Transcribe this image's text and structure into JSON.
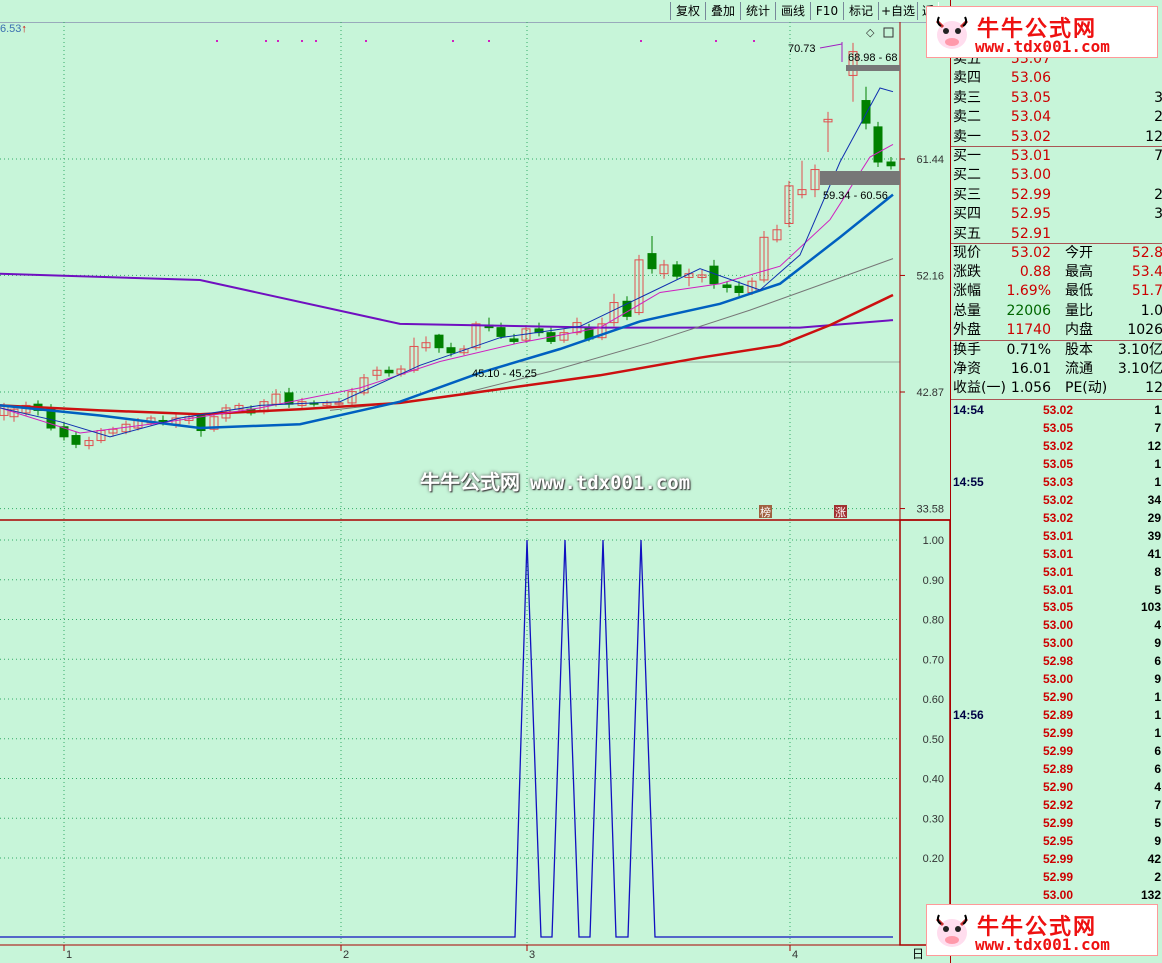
{
  "toolbar": {
    "buttons": [
      "复权",
      "叠加",
      "统计",
      "画线",
      "F10",
      "标记",
      "+自选",
      "返"
    ]
  },
  "chart": {
    "top_price_label": "6.53",
    "price_axis": [
      "61.44",
      "52.16",
      "42.87",
      "33.58"
    ],
    "indicator_axis": [
      "1.00",
      "0.90",
      "0.80",
      "0.70",
      "0.60",
      "0.50",
      "0.40",
      "0.30",
      "0.20"
    ],
    "x_axis": [
      "1",
      "2",
      "3",
      "4"
    ],
    "annotation_high": "70.73",
    "annotation_range_top": "68.98 - 68",
    "annotation_range_mid": "59.34 - 60.56",
    "annotation_range_low": "45.10 - 45.25",
    "badge_left": "榜",
    "badge_right": "涨",
    "bottom_right_label": "日",
    "watermark_cn": "牛牛公式网",
    "watermark_url": "www.tdx001.com"
  },
  "quote": {
    "sell": [
      {
        "label": "卖五",
        "price": "53.07",
        "vol": ""
      },
      {
        "label": "卖四",
        "price": "53.06",
        "vol": ""
      },
      {
        "label": "卖三",
        "price": "53.05",
        "vol": "3"
      },
      {
        "label": "卖二",
        "price": "53.04",
        "vol": "2"
      },
      {
        "label": "卖一",
        "price": "53.02",
        "vol": "12"
      }
    ],
    "buy": [
      {
        "label": "买一",
        "price": "53.01",
        "vol": "7"
      },
      {
        "label": "买二",
        "price": "53.00",
        "vol": ""
      },
      {
        "label": "买三",
        "price": "52.99",
        "vol": "2"
      },
      {
        "label": "买四",
        "price": "52.95",
        "vol": "3"
      },
      {
        "label": "买五",
        "price": "52.91",
        "vol": ""
      }
    ],
    "stats": [
      {
        "l1": "现价",
        "v1": "53.02",
        "l2": "今开",
        "v2": "52.8"
      },
      {
        "l1": "涨跌",
        "v1": "0.88",
        "l2": "最高",
        "v2": "53.4"
      },
      {
        "l1": "涨幅",
        "v1": "1.69%",
        "l2": "最低",
        "v2": "51.7"
      },
      {
        "l1": "总量",
        "v1": "22006",
        "l2": "量比",
        "v2": "1.0"
      },
      {
        "l1": "外盘",
        "v1": "11740",
        "l2": "内盘",
        "v2": "1026"
      }
    ],
    "stats2": [
      {
        "l1": "换手",
        "v1": "0.71%",
        "l2": "股本",
        "v2": "3.10亿"
      },
      {
        "l1": "净资",
        "v1": "16.01",
        "l2": "流通",
        "v2": "3.10亿"
      },
      {
        "l1": "收益(一)",
        "v1": "1.056",
        "l2": "PE(动)",
        "v2": "12"
      }
    ]
  },
  "ticks": [
    {
      "time": "14:54",
      "price": "53.02",
      "vol": "1"
    },
    {
      "time": "",
      "price": "53.05",
      "vol": "7"
    },
    {
      "time": "",
      "price": "53.02",
      "vol": "12"
    },
    {
      "time": "",
      "price": "53.05",
      "vol": "1"
    },
    {
      "time": "14:55",
      "price": "53.03",
      "vol": "1"
    },
    {
      "time": "",
      "price": "53.02",
      "vol": "34"
    },
    {
      "time": "",
      "price": "53.02",
      "vol": "29"
    },
    {
      "time": "",
      "price": "53.01",
      "vol": "39"
    },
    {
      "time": "",
      "price": "53.01",
      "vol": "41"
    },
    {
      "time": "",
      "price": "53.01",
      "vol": "8"
    },
    {
      "time": "",
      "price": "53.01",
      "vol": "5"
    },
    {
      "time": "",
      "price": "53.05",
      "vol": "103"
    },
    {
      "time": "",
      "price": "53.00",
      "vol": "4"
    },
    {
      "time": "",
      "price": "53.00",
      "vol": "9"
    },
    {
      "time": "",
      "price": "52.98",
      "vol": "6"
    },
    {
      "time": "",
      "price": "53.00",
      "vol": "9"
    },
    {
      "time": "",
      "price": "52.90",
      "vol": "1"
    },
    {
      "time": "14:56",
      "price": "52.89",
      "vol": "1"
    },
    {
      "time": "",
      "price": "52.99",
      "vol": "1"
    },
    {
      "time": "",
      "price": "52.99",
      "vol": "6"
    },
    {
      "time": "",
      "price": "52.89",
      "vol": "6"
    },
    {
      "time": "",
      "price": "52.90",
      "vol": "4"
    },
    {
      "time": "",
      "price": "52.92",
      "vol": "7"
    },
    {
      "time": "",
      "price": "52.99",
      "vol": "5"
    },
    {
      "time": "",
      "price": "52.95",
      "vol": "9"
    },
    {
      "time": "",
      "price": "52.99",
      "vol": "42"
    },
    {
      "time": "",
      "price": "52.99",
      "vol": "2"
    },
    {
      "time": "",
      "price": "53.00",
      "vol": "132"
    }
  ],
  "logo": {
    "title": "牛牛公式网",
    "url": "www.tdx001.com"
  },
  "colors": {
    "bg": "#c7f5d9",
    "up": "#e05050",
    "down": "#008000",
    "ma_blue": "#0060c0",
    "ma_red": "#cc1010",
    "ma_purple": "#7010c0",
    "indicator": "#1010c0"
  }
}
